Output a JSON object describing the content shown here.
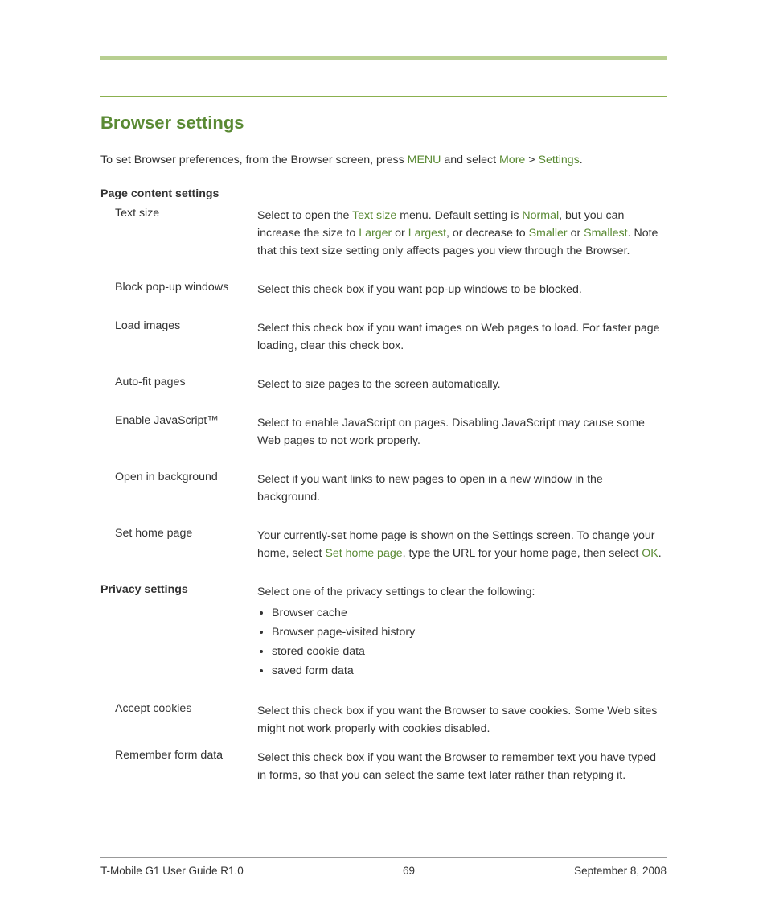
{
  "section_title": "Browser settings",
  "intro": {
    "pre": "To set Browser preferences, from the Browser screen, press ",
    "menu": "MENU",
    "mid": " and select ",
    "more": "More",
    "gt": " > ",
    "settings": "Settings",
    "post": "."
  },
  "page_content_heading": "Page content settings",
  "rows": {
    "text_size": {
      "label": "Text size",
      "d0": "Select to open the ",
      "k0": "Text size",
      "d1": " menu. Default setting is ",
      "k1": "Normal",
      "d2": ", but you can increase the size to ",
      "k2": "Larger",
      "d3": " or ",
      "k3": "Largest",
      "d4": ", or decrease to ",
      "k4": "Smaller",
      "d5": " or ",
      "k5": "Smallest",
      "d6": ". Note that this text size setting only affects pages you view through the Browser."
    },
    "block_popups": {
      "label": "Block pop-up windows",
      "desc": "Select this check box if you want pop-up windows to be blocked."
    },
    "load_images": {
      "label": "Load images",
      "desc": "Select this check box if you want images on Web pages to load. For faster page loading, clear this check box."
    },
    "autofit": {
      "label": "Auto-fit pages",
      "desc": "Select to size pages to the screen automatically."
    },
    "enable_js": {
      "label": "Enable JavaScript™",
      "desc": "Select to enable JavaScript on pages. Disabling JavaScript may cause some Web pages to not work properly."
    },
    "open_bg": {
      "label": "Open in background",
      "desc": "Select if you want links to new pages to open in a new window in the background."
    },
    "home": {
      "label": "Set home page",
      "d0": "Your currently-set home page is shown on the Settings screen. To change your home, select ",
      "k0": "Set home page",
      "d1": ", type the URL for your home page, then select ",
      "k1": "OK",
      "d2": "."
    }
  },
  "privacy_heading": "Privacy settings",
  "privacy_intro": "Select one of the privacy settings to clear the following:",
  "privacy_bullets": {
    "b0": "Browser cache",
    "b1": "Browser page-visited history",
    "b2": "stored cookie data",
    "b3": "saved form data"
  },
  "privacy_rows": {
    "cookies": {
      "label": "Accept cookies",
      "desc": "Select this check box if you want the Browser to save cookies. Some Web sites might not work properly with cookies disabled."
    },
    "formdata": {
      "label": "Remember form data",
      "desc": "Select this check box if you want the Browser to remember text you have typed in forms, so that you can select the same text later rather than retyping it."
    }
  },
  "footer": {
    "left": "T-Mobile G1 User Guide R1.0",
    "center": "69",
    "right": "September 8, 2008"
  }
}
